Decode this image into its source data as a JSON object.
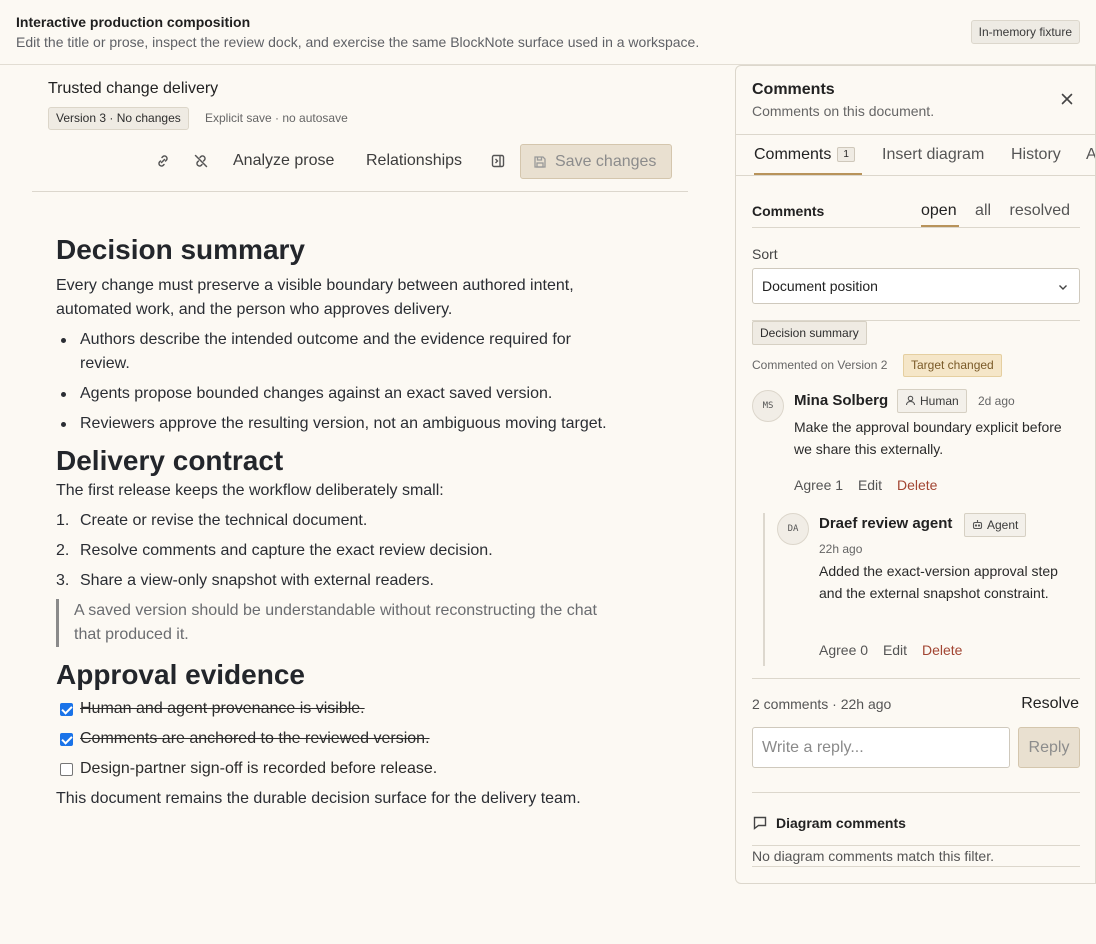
{
  "header": {
    "title": "Interactive production composition",
    "subtitle": "Edit the title or prose, inspect the review dock, and exercise the same BlockNote surface used in a workspace.",
    "fixture_badge": "In-memory fixture"
  },
  "editor": {
    "doc_title": "Trusted change delivery",
    "version_badge": "Version 3 · No changes",
    "save_mode": "Explicit save · no autosave",
    "toolbar": {
      "link_icon": "link-icon",
      "unlink_icon": "unlink-icon",
      "analyze_label": "Analyze prose",
      "relationships_label": "Relationships",
      "panel_icon": "panel-toggle-icon",
      "save_label": "Save changes"
    },
    "sections": {
      "s1": {
        "heading": "Decision summary",
        "para": "Every change must preserve a visible boundary between authored intent, automated work, and the person who approves delivery.",
        "bullets": [
          "Authors describe the intended outcome and the evidence required for review.",
          "Agents propose bounded changes against an exact saved version.",
          "Reviewers approve the resulting version, not an ambiguous moving target."
        ]
      },
      "s2": {
        "heading": "Delivery contract",
        "para": "The first release keeps the workflow deliberately small:",
        "steps": [
          {
            "num": "1.",
            "text": "Create or revise the technical document."
          },
          {
            "num": "2.",
            "text": "Resolve comments and capture the exact review decision."
          },
          {
            "num": "3.",
            "text": "Share a view-only snapshot with external readers."
          }
        ],
        "quote": "A saved version should be understandable without reconstructing the chat that produced it."
      },
      "s3": {
        "heading": "Approval evidence",
        "checks": [
          {
            "text": "Human and agent provenance is visible.",
            "checked": true
          },
          {
            "text": "Comments are anchored to the reviewed version.",
            "checked": true
          },
          {
            "text": "Design-partner sign-off is recorded before release.",
            "checked": false
          }
        ],
        "closing": "This document remains the durable decision surface for the delivery team."
      }
    }
  },
  "panel": {
    "title": "Comments",
    "subtitle": "Comments on this document.",
    "close_icon": "close-icon",
    "tabs": [
      {
        "label": "Comments",
        "count": "1"
      },
      {
        "label": "Insert diagram"
      },
      {
        "label": "History"
      },
      {
        "label": "A"
      }
    ],
    "comments_label": "Comments",
    "filters": [
      "open",
      "all",
      "resolved"
    ],
    "sort_label": "Sort",
    "sort_value": "Document position",
    "thread": {
      "anchor": "Decision summary",
      "commented_on": "Commented on Version 2",
      "target_badge": "Target changed",
      "comments": [
        {
          "initials": "MS",
          "author": "Mina Solberg",
          "kind": "Human",
          "time": "2d ago",
          "body": "Make the approval boundary explicit before we share this externally.",
          "agree": "Agree 1",
          "edit": "Edit",
          "delete": "Delete"
        },
        {
          "initials": "DA",
          "author": "Draef review agent",
          "kind": "Agent",
          "time": "22h ago",
          "body": "Added the exact-version approval step and the external snapshot constraint.",
          "agree": "Agree 0",
          "edit": "Edit",
          "delete": "Delete"
        }
      ],
      "meta": "2 comments · 22h ago",
      "resolve_label": "Resolve",
      "reply_placeholder": "Write a reply...",
      "reply_label": "Reply"
    },
    "diagram": {
      "title": "Diagram comments",
      "empty": "No diagram comments match this filter."
    }
  },
  "colors": {
    "background": "#fcf9f3",
    "accent_underline": "#b8935a",
    "delete": "#a24532",
    "target_changed_bg": "#f5e6c8"
  }
}
